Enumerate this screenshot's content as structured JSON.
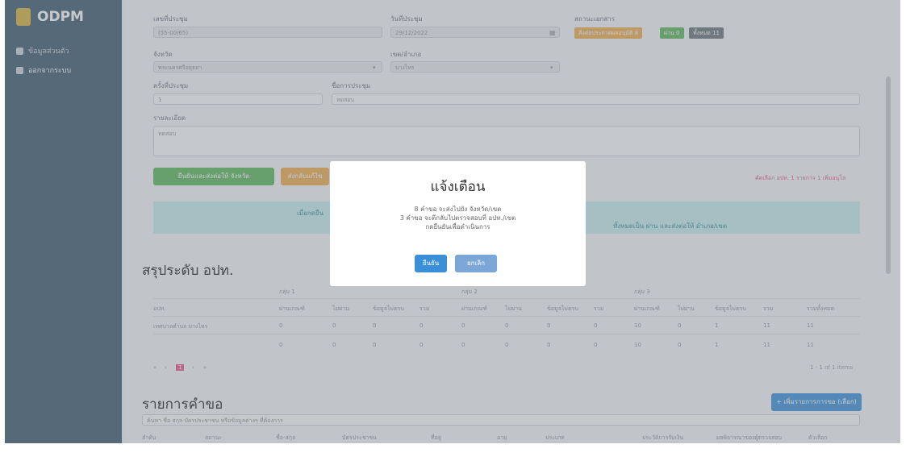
{
  "app": {
    "name": "ODPM"
  },
  "sidebar": {
    "items": [
      {
        "label": "ข้อมูลส่วนตัว"
      },
      {
        "label": "ออกจากระบบ"
      }
    ]
  },
  "form": {
    "meeting_no": {
      "label": "เลขที่ประชุม",
      "value": "(55-00/65)"
    },
    "meeting_date": {
      "label": "วันที่ประชุม",
      "value": "29/12/2022"
    },
    "status": {
      "label": "สถานะเอกสาร",
      "badges": [
        "สิ่งต่อประกาศผลอนุมัติ 8",
        "ผ่าน 0",
        "ทั้งหมด 11"
      ]
    },
    "province": {
      "label": "จังหวัด",
      "value": "พระนครศรีอยุธยา"
    },
    "district": {
      "label": "เขต/อำเภอ",
      "value": "บางไทร"
    },
    "round": {
      "label": "ครั้งที่ประชุม",
      "value": "1"
    },
    "meeting_name": {
      "label": "ชื่อการประชุม",
      "value": "ทดสอบ"
    },
    "detail": {
      "label": "รายละเอียด",
      "value": "ทดสอบ"
    }
  },
  "actions": {
    "send_label": "ยืนยันและส่งต่อให้ จังหวัด",
    "orange_label": "ส่งกลับแก้ไข",
    "right_note": "คัดเลือก อปท. 1 รายการ 1 เพิ่มอนุโล"
  },
  "info": {
    "left": "เมื่อกดยืน",
    "right": "ทั้งหมดเป็น ผ่าน และส่งต่อให้ อำเภอ/เขต"
  },
  "summary": {
    "title": "สรุประดับ อปท.",
    "groups": [
      "กลุ่ม 1",
      "กลุ่ม 2",
      "กลุ่ม 3"
    ],
    "subheaders": [
      "อปท.",
      "ผ่านเกณฑ์",
      "ไม่ผ่าน",
      "ข้อมูลไม่ครบ",
      "รวม",
      "ผ่านเกณฑ์",
      "ไม่ผ่าน",
      "ข้อมูลไม่ครบ",
      "รวม",
      "ผ่านเกณฑ์",
      "ไม่ผ่าน",
      "ข้อมูลไม่ครบ",
      "รวม",
      "รวมทั้งหมด"
    ],
    "rows": [
      [
        "เทศบาลตำบล บางไทร",
        "0",
        "0",
        "0",
        "0",
        "0",
        "0",
        "0",
        "0",
        "10",
        "0",
        "1",
        "11",
        "11"
      ],
      [
        "",
        "0",
        "0",
        "0",
        "0",
        "0",
        "0",
        "0",
        "0",
        "10",
        "0",
        "1",
        "11",
        "11"
      ]
    ],
    "pager": [
      "«",
      "‹",
      "1",
      "›",
      "»"
    ],
    "range_text": "1 - 1 of 1 items"
  },
  "requests": {
    "title": "รายการคำขอ",
    "button": "+ เพิ่มรายการการขอ (เลือก)",
    "search_placeholder": "ค้นหา ชื่อ สกุล บัตรประชาชน หรือข้อมูลต่างๆ ที่ต้องการ",
    "columns": [
      "ลำดับ",
      "สถานะ",
      "ชื่อ-สกุล",
      "บัตรประชาชน",
      "ที่อยู่",
      "อายุ",
      "ประเภท",
      "ประวัติการรับเงิน",
      "ผลพิจารณาของผู้ตรวจสอบ",
      "ตัวเลือก"
    ]
  },
  "dialog": {
    "title": "แจ้งเตือน",
    "lines": [
      "8 คำขอ จะส่งไปยัง จังหวัด/เขต",
      "3 คำขอ จะตีกลับไปตรวจสอบที่ อปท./เขต",
      "กดยืนยันเพื่อดำเนินการ"
    ],
    "confirm": "ยืนยัน",
    "cancel": "ยกเลิก"
  },
  "colors": {
    "sidebar": "#3f5a70",
    "green": "#5cb85c",
    "orange": "#f0ad4e",
    "blue": "#3b8fd9",
    "info": "#c7eef0"
  }
}
